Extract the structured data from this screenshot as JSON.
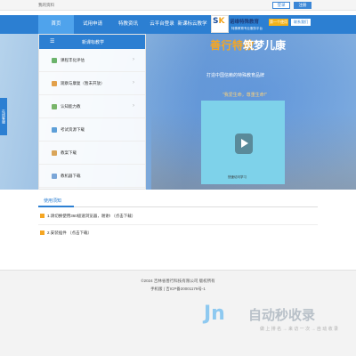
{
  "topbar": {
    "my_profile": "我的资料",
    "login": "登录",
    "register": "注册"
  },
  "nav": {
    "home": "首页",
    "item1": "试用申请",
    "item2": "特教资讯",
    "item3": "云平台登录",
    "item4": "新课标云教学"
  },
  "logo": {
    "mark_s": "S",
    "mark_k": "K",
    "text": "诺维特殊教育",
    "tagline": "特殊教育专业服务平台",
    "contact1": "第一个使用",
    "contact2": "联系我们"
  },
  "banner": {
    "slogan_orange": "善行特教",
    "slogan_white": "筑梦儿康",
    "subtitle": "打造中国信赖的特殊教育品牌",
    "quote": "\"我爱生命，尊重生命!\"",
    "video_caption": "快速访问学习"
  },
  "side_tab": "在线客服",
  "menu": {
    "title": "新课标教学",
    "items": [
      {
        "label": "课程丰化评估",
        "icon": "assessment-icon",
        "color": "#6bb36b"
      },
      {
        "label": "观察与康复（暂未开放）",
        "icon": "observation-icon",
        "color": "#e2a04b"
      },
      {
        "label": "认知能力教",
        "icon": "cognition-icon",
        "color": "#79b56a"
      },
      {
        "label": "考试资源下载",
        "icon": "exam-icon",
        "color": "#5d9fd8"
      },
      {
        "label": "教案下载",
        "icon": "lesson-icon",
        "color": "#d9a55a"
      },
      {
        "label": "教机器下载",
        "icon": "device-icon",
        "color": "#7aa6d8"
      }
    ]
  },
  "notice": {
    "tab_label": "使用须知",
    "rows": [
      {
        "text": "1.请切换使用360极速浏览器，谢谢! （点击下载）"
      },
      {
        "text": "2.安装插件 （点击下载）"
      }
    ]
  },
  "footer": {
    "copyright": "©2024 吉林省善行科技有限公司 版权所有",
    "icp": "手机版 | 吉ICP备20001179号-1"
  },
  "watermark": {
    "logo": "Jn",
    "name": "自动秒收录",
    "sub": "做 上 排 名 → 来 访 一 次 → 自 动 收 录"
  },
  "colors": {
    "primary": "#2c7fd2",
    "accent": "#f5a623"
  }
}
